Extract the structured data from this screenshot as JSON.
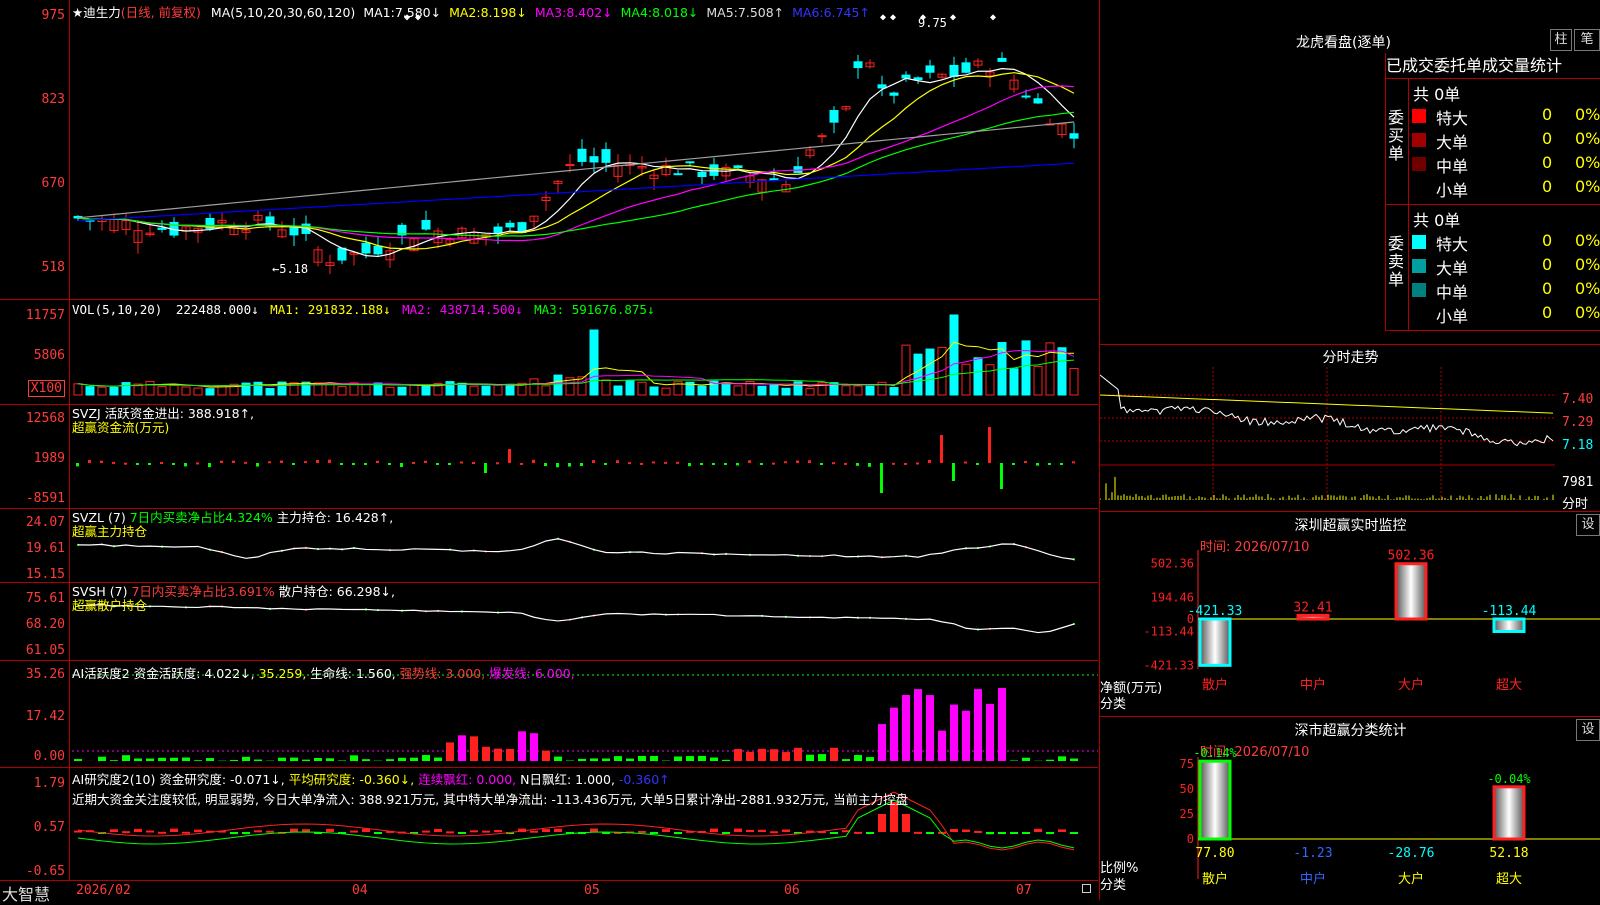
{
  "colors": {
    "up": "#ff2020",
    "down": "#00ffff",
    "grid": "#b00000",
    "axis": "#ff3c3c",
    "ma1": "#ffffff",
    "ma2": "#ffff00",
    "ma3": "#ff00ff",
    "ma4": "#00ff00",
    "ma5": "#a0a0a0",
    "ma6": "#0000ff",
    "magenta": "#ff00ff",
    "green": "#00ff00",
    "yellow": "#ffff00",
    "cyan": "#00ffff"
  },
  "main": {
    "star": "★",
    "name": "迪生力",
    "mode": "(日线, 前复权)",
    "ma_params": "MA(5,10,20,30,60,120)",
    "ma": [
      {
        "k": "MA1:",
        "v": "7.580↓"
      },
      {
        "k": "MA2:",
        "v": "8.198↓"
      },
      {
        "k": "MA3:",
        "v": "8.402↓"
      },
      {
        "k": "MA4:",
        "v": "8.018↓"
      },
      {
        "k": "MA5:",
        "v": "7.508↑"
      },
      {
        "k": "MA6:",
        "v": "6.745↑"
      }
    ],
    "y_labels": [
      "975",
      "823",
      "670",
      "518"
    ],
    "low_marker": "←5.18",
    "high_marker": "9.75"
  },
  "vol": {
    "hdr": "VOL(5,10,20)",
    "v": "222488.000↓",
    "ma1": "MA1: 291832.188↓",
    "ma2": "MA2: 438714.500↓",
    "ma3": "MA3: 591676.875↓",
    "y_labels": [
      "11757",
      "5806"
    ],
    "unit": "X100"
  },
  "svzj": {
    "line1": "SVZJ  活跃资金进出: 388.918↑,",
    "line2": "超赢资金流(万元)",
    "y_labels": [
      "12568",
      "1989",
      "-8591"
    ]
  },
  "svzl": {
    "line1a": "SVZL (7)",
    "line1b": "7日内买卖净占比4.324%",
    "line1c": "主力持仓: 16.428↑,",
    "line2": "超赢主力持仓",
    "y_labels": [
      "24.07",
      "19.61",
      "15.15"
    ]
  },
  "svsh": {
    "line1a": "SVSH (7)",
    "line1b": "7日内买卖净占比3.691%",
    "line1c": "散户持仓: 66.298↓,",
    "line2": "超赢散户持仓",
    "y_labels": [
      "75.61",
      "68.20",
      "61.05"
    ]
  },
  "ai2": {
    "a": "AI活跃度2",
    "b": "资金活跃度: 4.022↓,",
    "c": "35.259,",
    "d": "生命线: 1.560,",
    "e": "强势线: 3.000,",
    "f": "爆发线: 6.000,",
    "y_labels": [
      "35.26",
      "17.42",
      "0.00"
    ]
  },
  "aiy": {
    "a": "AI研究度2(10)",
    "b": "资金研究度: -0.071↓,",
    "c": "平均研究度: -0.360↓,",
    "d": "连续飘红: 0.000,",
    "e": "N日飘红: 1.000,",
    "f": "-0.360↑",
    "comment": "近期大资金关注度较低, 明显弱势, 今日大单净流入: 388.921万元, 其中特大单净流出: -113.436万元, 大单5日累计净出-2881.932万元, 当前主力控盘",
    "y_labels": [
      "1.79",
      "0.57",
      "-0.65"
    ]
  },
  "timeline": [
    "2026/02",
    "04",
    "05",
    "06",
    "07"
  ],
  "brand": "大智慧",
  "lhb": {
    "title": "龙虎看盘(逐单)",
    "btn1": "柱",
    "btn2": "笔",
    "sub": "已成交委托单成交量统计",
    "buy_label": "委买单",
    "sell_label": "委卖单",
    "total": "共 0单",
    "buy_rows": [
      {
        "n": "特大",
        "c": "#ff0000",
        "q": "0",
        "p": "0%"
      },
      {
        "n": "大单",
        "c": "#a00000",
        "q": "0",
        "p": "0%"
      },
      {
        "n": "中单",
        "c": "#700000",
        "q": "0",
        "p": "0%"
      },
      {
        "n": "小单",
        "c": "",
        "q": "0",
        "p": "0%"
      }
    ],
    "sell_rows": [
      {
        "n": "特大",
        "c": "#00ffff",
        "q": "0",
        "p": "0%"
      },
      {
        "n": "大单",
        "c": "#00a0a0",
        "q": "0",
        "p": "0%"
      },
      {
        "n": "中单",
        "c": "#008080",
        "q": "0",
        "p": "0%"
      },
      {
        "n": "小单",
        "c": "",
        "q": "0",
        "p": "0%"
      }
    ]
  },
  "fenshi": {
    "title": "分时走势",
    "y_labels": [
      "7.40",
      "7.29",
      "7.18"
    ],
    "vol_label": "7981",
    "tag": "分时"
  },
  "szcy": {
    "title": "深圳超赢实时监控",
    "btn": "设",
    "time": "时间: 2026/07/10",
    "y_labels": [
      "502.36",
      "194.46",
      "0",
      "-113.44",
      "-421.33"
    ],
    "side": "净额(万元)",
    "side2": "分类",
    "bars": [
      {
        "cat": "散户",
        "v": -421.33,
        "lbl": "-421.33"
      },
      {
        "cat": "中户",
        "v": 32.41,
        "lbl": "32.41"
      },
      {
        "cat": "大户",
        "v": 502.36,
        "lbl": "502.36"
      },
      {
        "cat": "超大",
        "v": -113.44,
        "lbl": "-113.44"
      }
    ]
  },
  "sccy": {
    "title": "深市超赢分类统计",
    "btn": "设",
    "time": "时间: 2026/07/10",
    "y_labels": [
      "75",
      "50",
      "25",
      "0"
    ],
    "side": "比例%",
    "side2": "分类",
    "bars": [
      {
        "cat": "散户",
        "v": 77.8,
        "lbl": "77.80",
        "top": "-0.14%"
      },
      {
        "cat": "中户",
        "v": -1.23,
        "lbl": "-1.23",
        "top": ""
      },
      {
        "cat": "大户",
        "v": -28.76,
        "lbl": "-28.76",
        "top": ""
      },
      {
        "cat": "超大",
        "v": 52.18,
        "lbl": "52.18",
        "top": "-0.04%"
      }
    ]
  }
}
